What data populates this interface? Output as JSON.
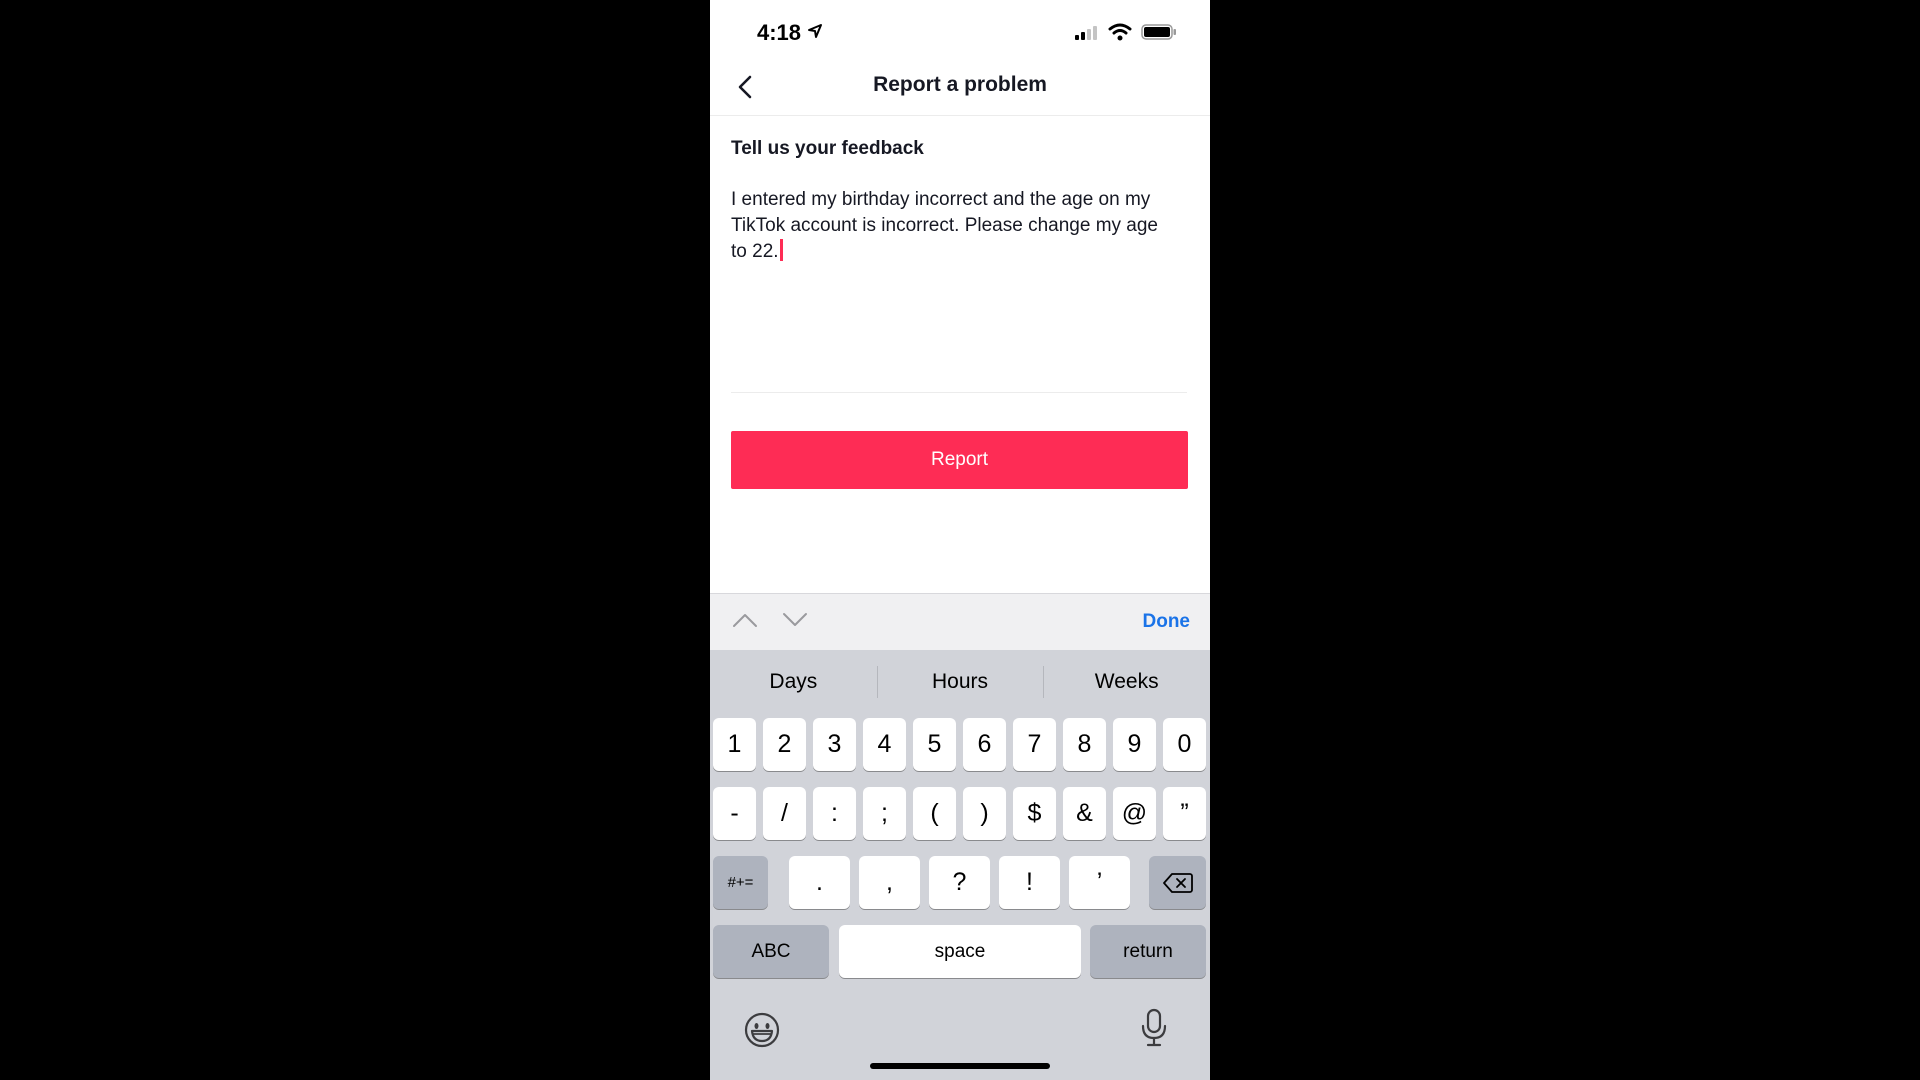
{
  "status_bar": {
    "time": "4:18"
  },
  "nav": {
    "title": "Report a problem"
  },
  "form": {
    "label": "Tell us your feedback",
    "feedback_line1": "I entered my birthday incorrect and the age on my",
    "feedback_line2": "TikTok account is incorrect. Please change my age",
    "feedback_line3": "to 22.",
    "button_label": "Report"
  },
  "keyboard_toolbar": {
    "done_label": "Done"
  },
  "keyboard": {
    "suggestions": [
      "Days",
      "Hours",
      "Weeks"
    ],
    "row1": [
      "1",
      "2",
      "3",
      "4",
      "5",
      "6",
      "7",
      "8",
      "9",
      "0"
    ],
    "row2": [
      "-",
      "/",
      ":",
      ";",
      "(",
      ")",
      "$",
      "&",
      "@",
      "”"
    ],
    "row3_mode": "#+=",
    "row3": [
      ".",
      ",",
      "?",
      "!",
      "’"
    ],
    "abc_label": "ABC",
    "space_label": "space",
    "return_label": "return"
  },
  "colors": {
    "accent": "#fe2c55",
    "link": "#1a73e8"
  }
}
